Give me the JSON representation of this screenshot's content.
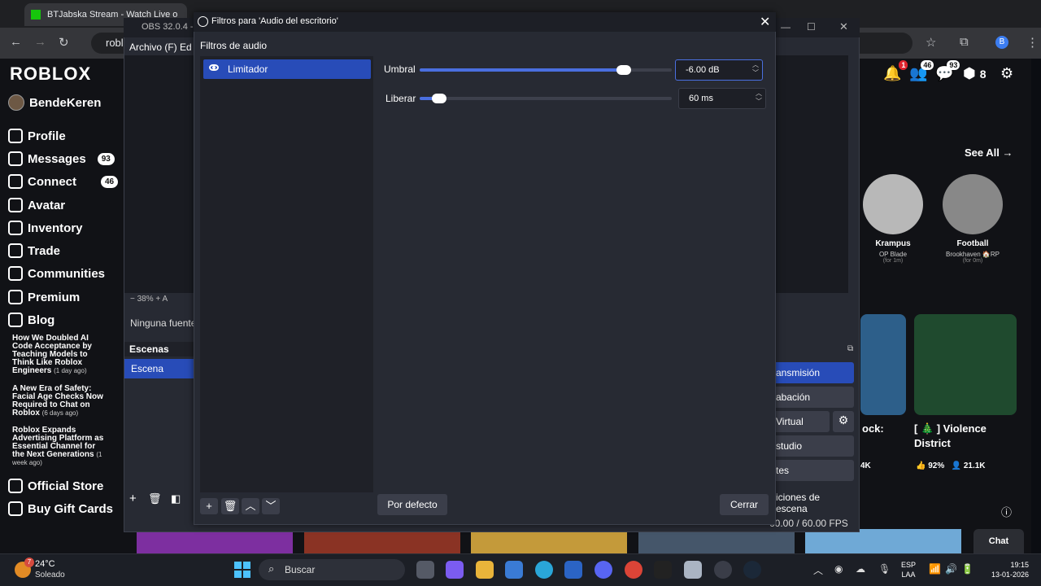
{
  "browser": {
    "tab_active_title": "BTJabska Stream - Watch Live o",
    "tab_obs_title": "OBS 32.0.4 - P",
    "address_text": "robl"
  },
  "roblox": {
    "logo": "ROBLOX",
    "username": "BendeKeren",
    "nav": [
      {
        "label": "Profile",
        "icon": "profile-icon"
      },
      {
        "label": "Messages",
        "icon": "messages-icon",
        "badge": "93"
      },
      {
        "label": "Connect",
        "icon": "connect-icon",
        "badge": "46"
      },
      {
        "label": "Avatar",
        "icon": "avatar-icon"
      },
      {
        "label": "Inventory",
        "icon": "inventory-icon"
      },
      {
        "label": "Trade",
        "icon": "trade-icon"
      },
      {
        "label": "Communities",
        "icon": "communities-icon"
      },
      {
        "label": "Premium",
        "icon": "premium-icon"
      },
      {
        "label": "Blog",
        "icon": "blog-icon"
      }
    ],
    "blog_posts": [
      {
        "title": "How We Doubled AI Code Acceptance by Teaching Models to Think Like Roblox Engineers",
        "age": "(1 day ago)"
      },
      {
        "title": "A New Era of Safety: Facial Age Checks Now Required to Chat on Roblox",
        "age": "(6 days ago)"
      },
      {
        "title": "Roblox Expands Advertising Platform as Essential Channel for the Next Generations",
        "age": "(1 week ago)"
      }
    ],
    "official_store": "Official Store",
    "buy_gift_cards": "Buy Gift Cards",
    "header_badges": {
      "notifications": "1",
      "friends": "46",
      "messages": "93",
      "robux": "8"
    },
    "see_all": "See All →",
    "friends": [
      {
        "name": "Krampus",
        "game": "OP Blade",
        "since": "(for 1m)"
      },
      {
        "name": "Football",
        "game": "Brookhaven 🏠RP",
        "since": "(for 0m)"
      }
    ],
    "games": [
      {
        "title": "ock:",
        "stat1": "",
        "stat2": "4K"
      },
      {
        "title": "[ 🎄 ] Violence District",
        "stat1": "92%",
        "stat2": "21.1K"
      }
    ],
    "chat": "Chat"
  },
  "obs": {
    "title": "OBS 32.0.4 - P",
    "menu": "Archivo (F)   Ed",
    "zoom": "−   38%   +   A",
    "sources_msg": "Ninguna fuente",
    "scenes_header": "Escenas",
    "scene_item": "Escena",
    "controls": [
      "ansmisión",
      "abación",
      "Virtual",
      "studio",
      "tes",
      "iciones de escena"
    ],
    "status": "60.00 / 60.00 FPS"
  },
  "dialog": {
    "title": "Filtros para 'Audio del escritorio'",
    "section_label": "Filtros de audio",
    "filters": [
      {
        "name": "Limitador",
        "visible": true
      }
    ],
    "threshold": {
      "label": "Umbral",
      "value_text": "-6.00 dB",
      "value_db": -6.0,
      "min_db": -60,
      "max_db": 0
    },
    "release": {
      "label": "Liberar",
      "value_text": "60 ms",
      "value_ms": 60,
      "min_ms": 1,
      "max_ms": 1000
    },
    "defaults_button": "Por defecto",
    "close_button": "Cerrar"
  },
  "taskbar": {
    "weather_temp": "24°C",
    "weather_desc": "Soleado",
    "weather_badge": "7",
    "search": "Buscar",
    "lang_line1": "ESP",
    "lang_line2": "LAA",
    "time": "19:15",
    "date": "13-01-2026"
  }
}
